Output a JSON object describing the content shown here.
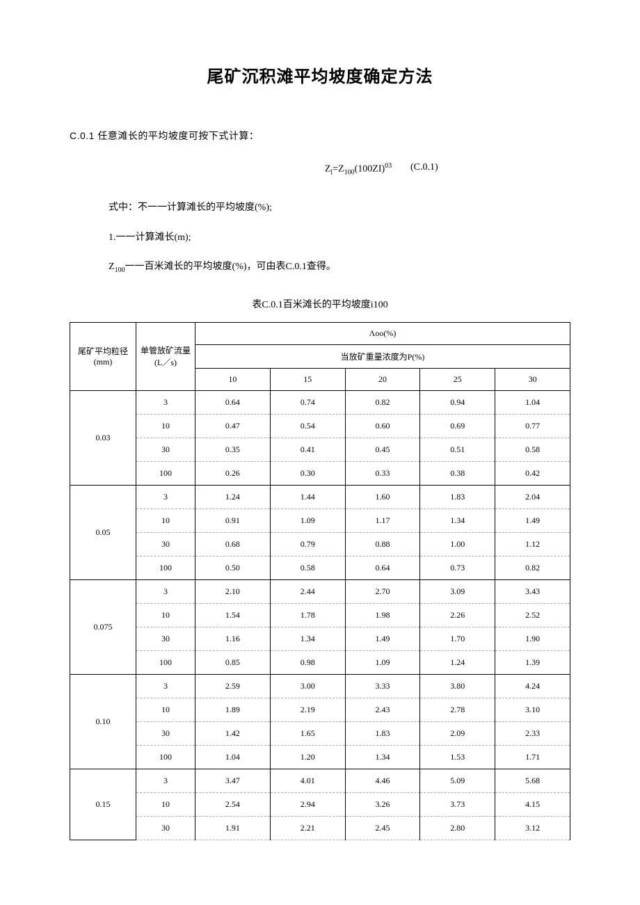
{
  "title": "尾矿沉积滩平均坡度确定方法",
  "section_label": "C.0.1 任意滩长的平均坡度可按下式计算：",
  "formula": {
    "lhs": "Z",
    "lhs_sub": "l",
    "eq": "=Z",
    "z100_sub": "100",
    "paren": "(100ZI)",
    "sup": "03",
    "num": "(C.0.1)"
  },
  "def1": "式中：不一一计算滩长的平均坡度(%);",
  "def2": "1.一一计算滩长(m);",
  "def3_pre": "Z",
  "def3_sub": "100",
  "def3_post": "一一百米滩长的平均坡度(%)，可由表C.0.1查得。",
  "table_caption": "表C.0.1百米滩长的平均坡度i100",
  "headers": {
    "diameter": "尾矿平均粒径(mm)",
    "flow": "单管放矿流量(L／s)",
    "top": "Λoo(%)",
    "conc": "当放矿重量浓度为P(%)",
    "p": [
      "10",
      "15",
      "20",
      "25",
      "30"
    ]
  },
  "chart_data": {
    "type": "table",
    "groups": [
      {
        "diameter": "0.03",
        "rows": [
          {
            "flow": "3",
            "v": [
              "0.64",
              "0.74",
              "0.82",
              "0.94",
              "1.04"
            ]
          },
          {
            "flow": "10",
            "v": [
              "0.47",
              "0.54",
              "0.60",
              "0.69",
              "0.77"
            ]
          },
          {
            "flow": "30",
            "v": [
              "0.35",
              "0.41",
              "0.45",
              "0.51",
              "0.58"
            ]
          },
          {
            "flow": "100",
            "v": [
              "0.26",
              "0.30",
              "0.33",
              "0.38",
              "0.42"
            ]
          }
        ]
      },
      {
        "diameter": "0.05",
        "rows": [
          {
            "flow": "3",
            "v": [
              "1.24",
              "1.44",
              "1.60",
              "1.83",
              "2.04"
            ]
          },
          {
            "flow": "10",
            "v": [
              "0.91",
              "1.09",
              "1.17",
              "1.34",
              "1.49"
            ]
          },
          {
            "flow": "30",
            "v": [
              "0.68",
              "0.79",
              "0.88",
              "1.00",
              "1.12"
            ]
          },
          {
            "flow": "100",
            "v": [
              "0.50",
              "0.58",
              "0.64",
              "0.73",
              "0.82"
            ]
          }
        ]
      },
      {
        "diameter": "0.075",
        "rows": [
          {
            "flow": "3",
            "v": [
              "2.10",
              "2.44",
              "2.70",
              "3.09",
              "3.43"
            ]
          },
          {
            "flow": "10",
            "v": [
              "1.54",
              "1.78",
              "1.98",
              "2.26",
              "2.52"
            ]
          },
          {
            "flow": "30",
            "v": [
              "1.16",
              "1.34",
              "1.49",
              "1.70",
              "1.90"
            ]
          },
          {
            "flow": "100",
            "v": [
              "0.85",
              "0.98",
              "1.09",
              "1.24",
              "1.39"
            ]
          }
        ]
      },
      {
        "diameter": "0.10",
        "rows": [
          {
            "flow": "3",
            "v": [
              "2.59",
              "3.00",
              "3.33",
              "3.80",
              "4.24"
            ]
          },
          {
            "flow": "10",
            "v": [
              "1.89",
              "2.19",
              "2.43",
              "2.78",
              "3.10"
            ]
          },
          {
            "flow": "30",
            "v": [
              "1.42",
              "1.65",
              "1.83",
              "2.09",
              "2.33"
            ]
          },
          {
            "flow": "100",
            "v": [
              "1.04",
              "1.20",
              "1.34",
              "1.53",
              "1.71"
            ]
          }
        ]
      },
      {
        "diameter": "0.15",
        "rows": [
          {
            "flow": "3",
            "v": [
              "3.47",
              "4.01",
              "4.46",
              "5.09",
              "5.68"
            ]
          },
          {
            "flow": "10",
            "v": [
              "2.54",
              "2.94",
              "3.26",
              "3.73",
              "4.15"
            ]
          },
          {
            "flow": "30",
            "v": [
              "1.91",
              "2.21",
              "2.45",
              "2.80",
              "3.12"
            ]
          }
        ]
      }
    ]
  }
}
